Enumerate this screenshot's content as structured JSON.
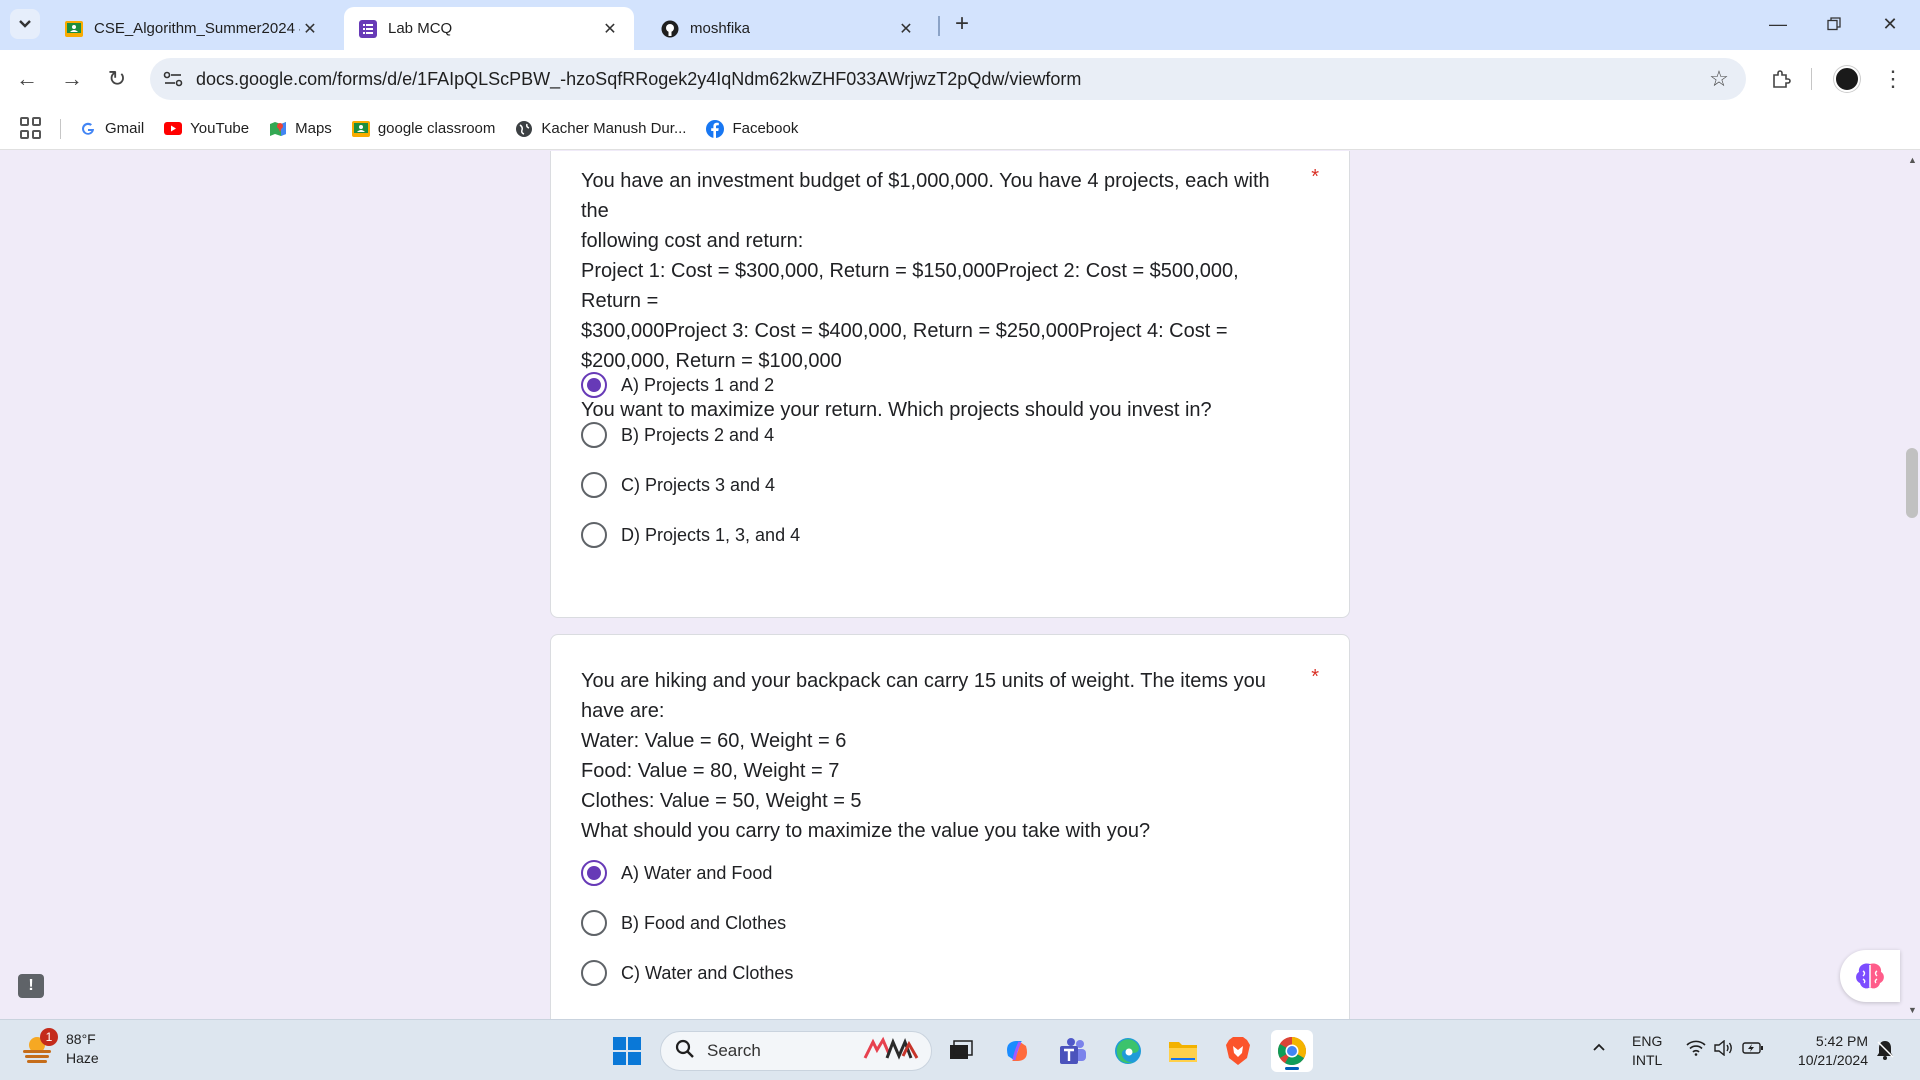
{
  "browser": {
    "tabs": [
      {
        "title": "CSE_Algorithm_Summer2024 4"
      },
      {
        "title": "Lab MCQ"
      },
      {
        "title": "moshfika"
      }
    ],
    "url": "docs.google.com/forms/d/e/1FAIpQLScPBW_-hzoSqfRRogek2y4IqNdm62kwZHF033AWrjwzT2pQdw/viewform",
    "bookmarks": [
      {
        "label": "Gmail"
      },
      {
        "label": "YouTube"
      },
      {
        "label": "Maps"
      },
      {
        "label": "google classroom"
      },
      {
        "label": "Kacher Manush Dur..."
      },
      {
        "label": "Facebook"
      }
    ]
  },
  "form": {
    "questions": [
      {
        "lines": [
          "You have an investment budget of $1,000,000. You have 4 projects, each with the",
          "following cost and return:",
          "Project 1: Cost = $300,000, Return = $150,000Project 2: Cost = $500,000, Return =",
          "$300,000Project 3: Cost = $400,000, Return = $250,000Project 4: Cost =",
          "$200,000, Return = $100,000"
        ],
        "prompt": "You want to maximize your return. Which projects should you invest in?",
        "required_mark": "*",
        "selected_option": "A) Projects 1 and 2",
        "options": [
          {
            "label": "A) Projects 1 and 2"
          },
          {
            "label": "B) Projects 2 and 4"
          },
          {
            "label": "C) Projects 3 and 4"
          },
          {
            "label": "D) Projects 1, 3, and 4"
          }
        ]
      },
      {
        "lines": [
          "You are hiking and your backpack can carry 15 units of weight. The items you",
          "have are:",
          "Water: Value = 60, Weight = 6",
          "Food: Value = 80, Weight = 7",
          "Clothes: Value = 50, Weight = 5",
          "What should you carry to maximize the value you take with you?"
        ],
        "required_mark": "*",
        "selected_option": "A) Water and Food",
        "options": [
          {
            "label": "A) Water and Food"
          },
          {
            "label": "B) Food and Clothes"
          },
          {
            "label": "C) Water and Clothes"
          }
        ]
      }
    ],
    "accent_color": "#673ab7"
  },
  "feedback_icon": "!",
  "taskbar": {
    "weather": {
      "temp": "88°F",
      "condition": "Haze",
      "badge": "1"
    },
    "search_placeholder": "Search",
    "language": {
      "line1": "ENG",
      "line2": "INTL"
    },
    "clock": {
      "time": "5:42 PM",
      "date": "10/21/2024"
    }
  }
}
